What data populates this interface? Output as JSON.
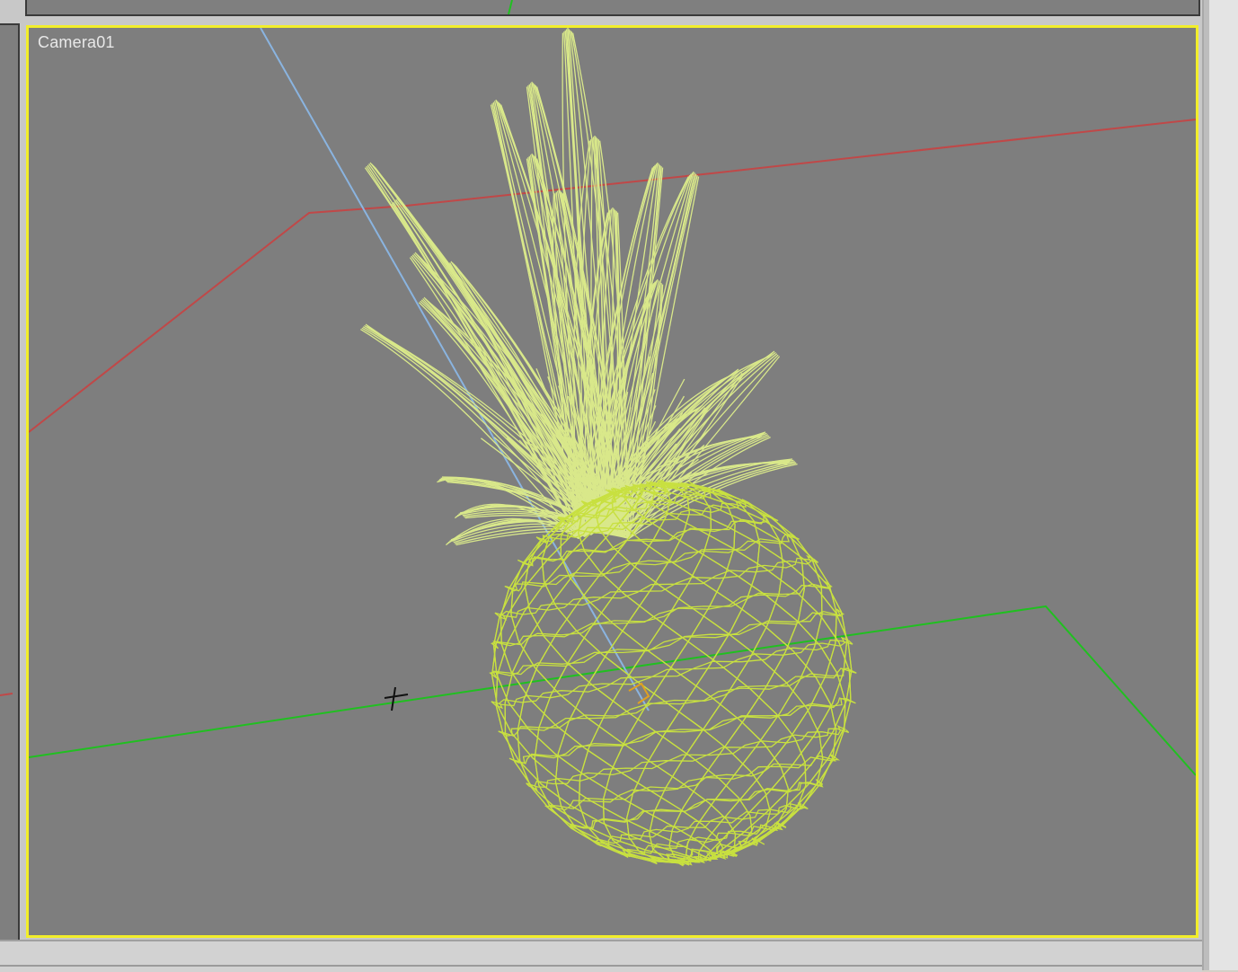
{
  "viewport": {
    "label": "Camera01",
    "active_border_color": "#f2ee2a",
    "background_color": "#7e7e7e"
  },
  "scene": {
    "object": "pineapple-wireframe",
    "wireframe_color": "#d9e88a",
    "body_wire_color": "#c8e040",
    "grid_colors": {
      "x_axis": "#c04848",
      "y_axis": "#20c020",
      "camera_target_line": "#8ab4e0"
    },
    "icons": {
      "cursor": "crosshair-cursor-icon",
      "pivot": "pivot-icon"
    }
  }
}
